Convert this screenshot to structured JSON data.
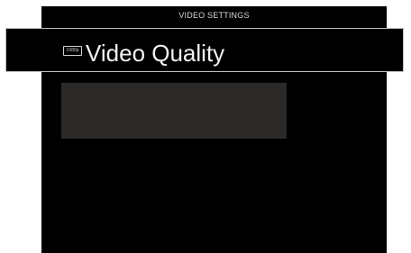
{
  "header": {
    "title": "VIDEO SETTINGS"
  },
  "menu": {
    "selected_item": {
      "icon": "resolution-1080p-icon",
      "badge_text": "1080p",
      "label": "Video Quality"
    }
  },
  "colors": {
    "background": "#000000",
    "text": "#f2f2f2",
    "selection_border": "#bfbfbf",
    "panel": "#2b2a29"
  }
}
